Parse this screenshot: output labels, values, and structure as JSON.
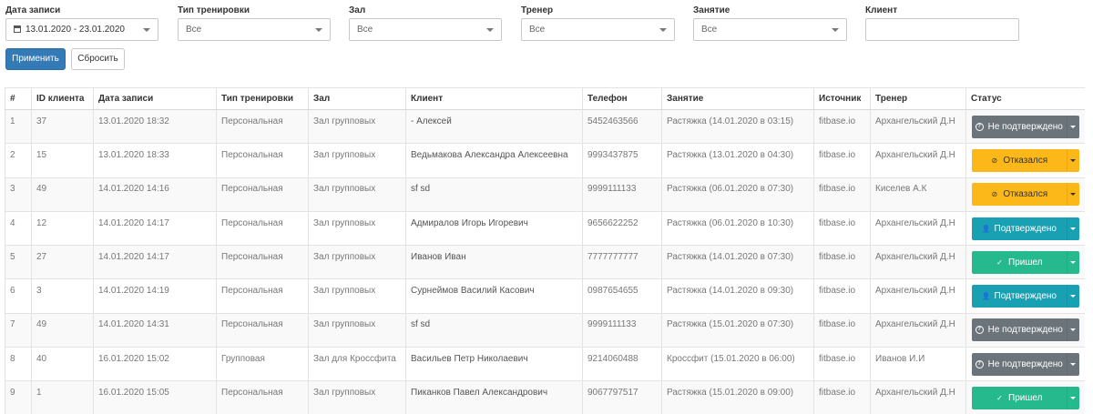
{
  "filters": {
    "date": {
      "label": "Дата записи",
      "value": "13.01.2020 - 23.01.2020"
    },
    "type": {
      "label": "Тип тренировки",
      "value": "Все"
    },
    "hall": {
      "label": "Зал",
      "value": "Все"
    },
    "trainer": {
      "label": "Тренер",
      "value": "Все"
    },
    "lesson": {
      "label": "Занятие",
      "value": "Все"
    },
    "client": {
      "label": "Клиент",
      "value": ""
    }
  },
  "actions": {
    "apply": "Применить",
    "reset": "Сбросить"
  },
  "table": {
    "columns": [
      "#",
      "ID клиента",
      "Дата записи",
      "Тип тренировки",
      "Зал",
      "Клиент",
      "Телефон",
      "Занятие",
      "Источник",
      "Тренер",
      "Статус"
    ],
    "rows": [
      {
        "n": "1",
        "id": "37",
        "date": "13.01.2020 18:32",
        "type": "Персональная",
        "hall": "Зал групповых",
        "client": "- Алексей",
        "phone": "5452463566",
        "lesson": "Растяжка (14.01.2020 в 03:15)",
        "source": "fitbase.io",
        "trainer": "Архангельский Д.Н",
        "status": "Не подтверждено"
      },
      {
        "n": "2",
        "id": "15",
        "date": "13.01.2020 18:33",
        "type": "Персональная",
        "hall": "Зал групповых",
        "client": "Ведьмакова Александра Алексеевна",
        "phone": "9993437875",
        "lesson": "Растяжка (13.01.2020 в 04:30)",
        "source": "fitbase.io",
        "trainer": "Архангельский Д.Н",
        "status": "Отказался"
      },
      {
        "n": "3",
        "id": "49",
        "date": "14.01.2020 14:16",
        "type": "Персональная",
        "hall": "Зал групповых",
        "client": "sf sd",
        "phone": "9999111133",
        "lesson": "Растяжка (06.01.2020 в 07:30)",
        "source": "fitbase.io",
        "trainer": "Киселев А.К",
        "status": "Отказался"
      },
      {
        "n": "4",
        "id": "12",
        "date": "14.01.2020 14:17",
        "type": "Персональная",
        "hall": "Зал групповых",
        "client": "Адмиралов Игорь Игоревич",
        "phone": "9656622252",
        "lesson": "Растяжка (06.01.2020 в 10:30)",
        "source": "fitbase.io",
        "trainer": "Архангельский Д.Н",
        "status": "Подтверждено"
      },
      {
        "n": "5",
        "id": "27",
        "date": "14.01.2020 14:17",
        "type": "Персональная",
        "hall": "Зал групповых",
        "client": "Иванов Иван",
        "phone": "7777777777",
        "lesson": "Растяжка (14.01.2020 в 07:30)",
        "source": "fitbase.io",
        "trainer": "Архангельский Д.Н",
        "status": "Пришел"
      },
      {
        "n": "6",
        "id": "3",
        "date": "14.01.2020 14:19",
        "type": "Персональная",
        "hall": "Зал групповых",
        "client": "Сурнеймов Василий Касович",
        "phone": "0987654655",
        "lesson": "Растяжка (14.01.2020 в 09:30)",
        "source": "fitbase.io",
        "trainer": "Архангельский Д.Н",
        "status": "Подтверждено"
      },
      {
        "n": "7",
        "id": "49",
        "date": "14.01.2020 14:31",
        "type": "Персональная",
        "hall": "Зал групповых",
        "client": "sf sd",
        "phone": "9999111133",
        "lesson": "Растяжка (15.01.2020 в 07:30)",
        "source": "fitbase.io",
        "trainer": "Архангельский Д.Н",
        "status": "Не подтверждено"
      },
      {
        "n": "8",
        "id": "40",
        "date": "16.01.2020 15:02",
        "type": "Групповая",
        "hall": "Зал для Кроссфита",
        "client": "Васильев Петр Николаевич",
        "phone": "9214060488",
        "lesson": "Кроссфит (15.01.2020 в 06:00)",
        "source": "fitbase.io",
        "trainer": "Иванов И.И",
        "status": "Не подтверждено"
      },
      {
        "n": "9",
        "id": "1",
        "date": "16.01.2020 15:05",
        "type": "Персональная",
        "hall": "Зал групповых",
        "client": "Пиканков Павел Александрович",
        "phone": "9067797517",
        "lesson": "Растяжка (15.01.2020 в 09:00)",
        "source": "fitbase.io",
        "trainer": "Архангельский Д.Н",
        "status": "Пришел"
      }
    ]
  },
  "status_styles": {
    "Не подтверждено": {
      "color": "#6c747b",
      "icon": "question-circle-icon"
    },
    "Отказался": {
      "color": "#fbb818",
      "icon": "ban-icon"
    },
    "Подтверждено": {
      "color": "#1aa0b3",
      "icon": "user-check-icon"
    },
    "Пришел": {
      "color": "#27b98e",
      "icon": "check-circle-icon"
    }
  }
}
